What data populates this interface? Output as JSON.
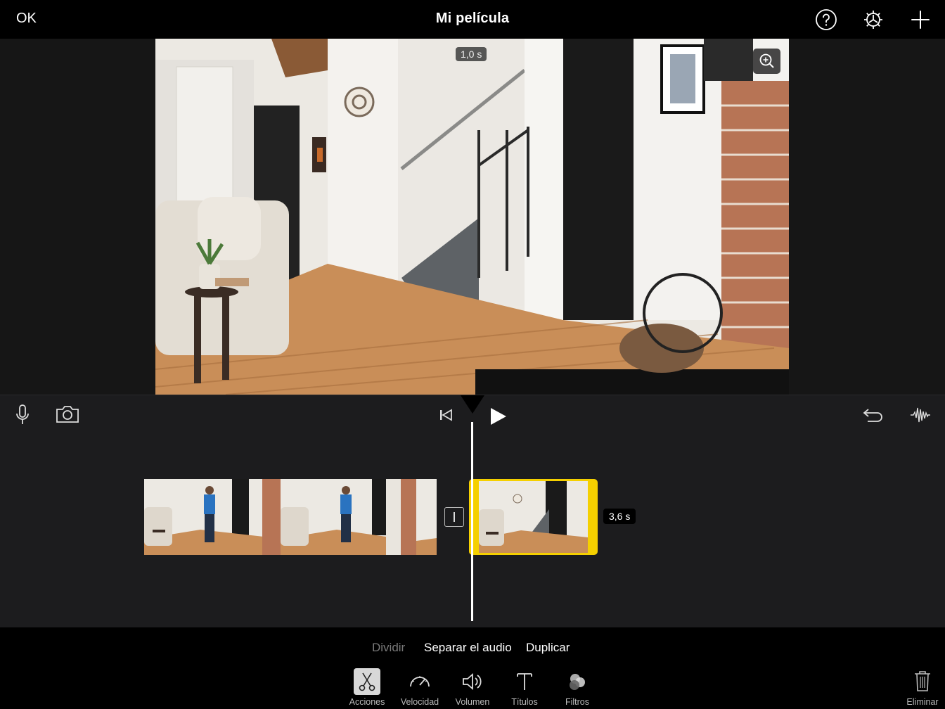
{
  "topbar": {
    "done_label": "OK",
    "title": "Mi película",
    "icons": [
      "help-icon",
      "settings-gear-icon",
      "add-plus-icon"
    ]
  },
  "viewer": {
    "time_chip": "1,0 s",
    "zoom_icon": "zoom-in-icon"
  },
  "controls": {
    "left_icons": [
      "microphone-icon",
      "camera-icon"
    ],
    "center_icons": [
      "skip-to-start-icon",
      "play-icon"
    ],
    "right_icons": [
      "undo-icon",
      "audio-waveform-icon"
    ]
  },
  "timeline": {
    "selected_clip_duration": "3,6 s",
    "selected_color": "#f5d000"
  },
  "actions": {
    "split_label": "Dividir",
    "detach_audio_label": "Separar el audio",
    "duplicate_label": "Duplicar"
  },
  "tools": [
    {
      "label": "Acciones",
      "icon": "scissors-icon",
      "active": true
    },
    {
      "label": "Velocidad",
      "icon": "speedometer-icon",
      "active": false
    },
    {
      "label": "Volumen",
      "icon": "speaker-icon",
      "active": false
    },
    {
      "label": "Títulos",
      "icon": "text-title-icon",
      "active": false
    },
    {
      "label": "Filtros",
      "icon": "filters-icon",
      "active": false
    }
  ],
  "delete_label": "Eliminar"
}
